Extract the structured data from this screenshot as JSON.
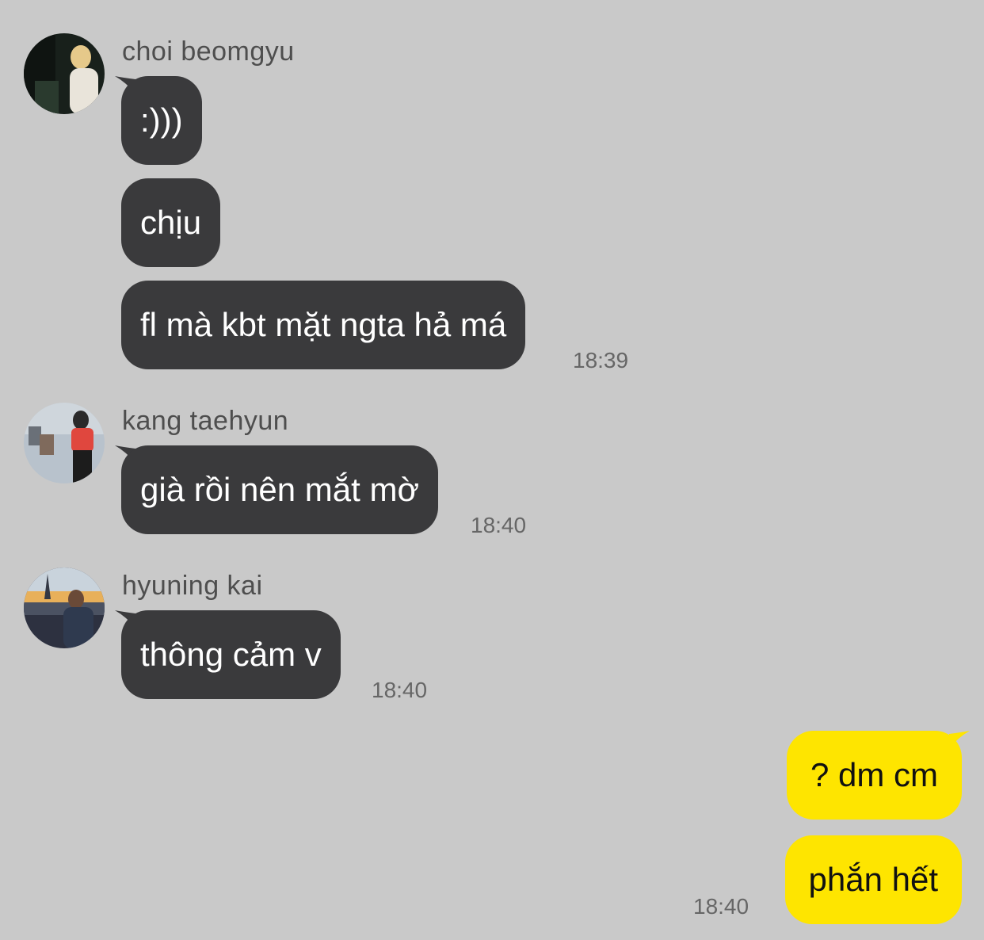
{
  "groups": [
    {
      "sender": "choi beomgyu",
      "avatar_icon": "profile-photo",
      "messages": [
        ":)))",
        "chịu",
        "fl mà kbt mặt ngta hả má"
      ],
      "time": "18:39"
    },
    {
      "sender": "kang taehyun",
      "avatar_icon": "profile-photo",
      "messages": [
        "già rồi nên mắt mờ"
      ],
      "time": "18:40"
    },
    {
      "sender": "hyuning kai",
      "avatar_icon": "profile-photo",
      "messages": [
        "thông cảm v"
      ],
      "time": "18:40"
    }
  ],
  "outgoing": {
    "messages": [
      "? dm cm",
      "phắn hết"
    ],
    "time": "18:40"
  },
  "colors": {
    "background": "#c9c9c9",
    "incoming_bubble": "#3a3a3c",
    "outgoing_bubble": "#fee500"
  }
}
